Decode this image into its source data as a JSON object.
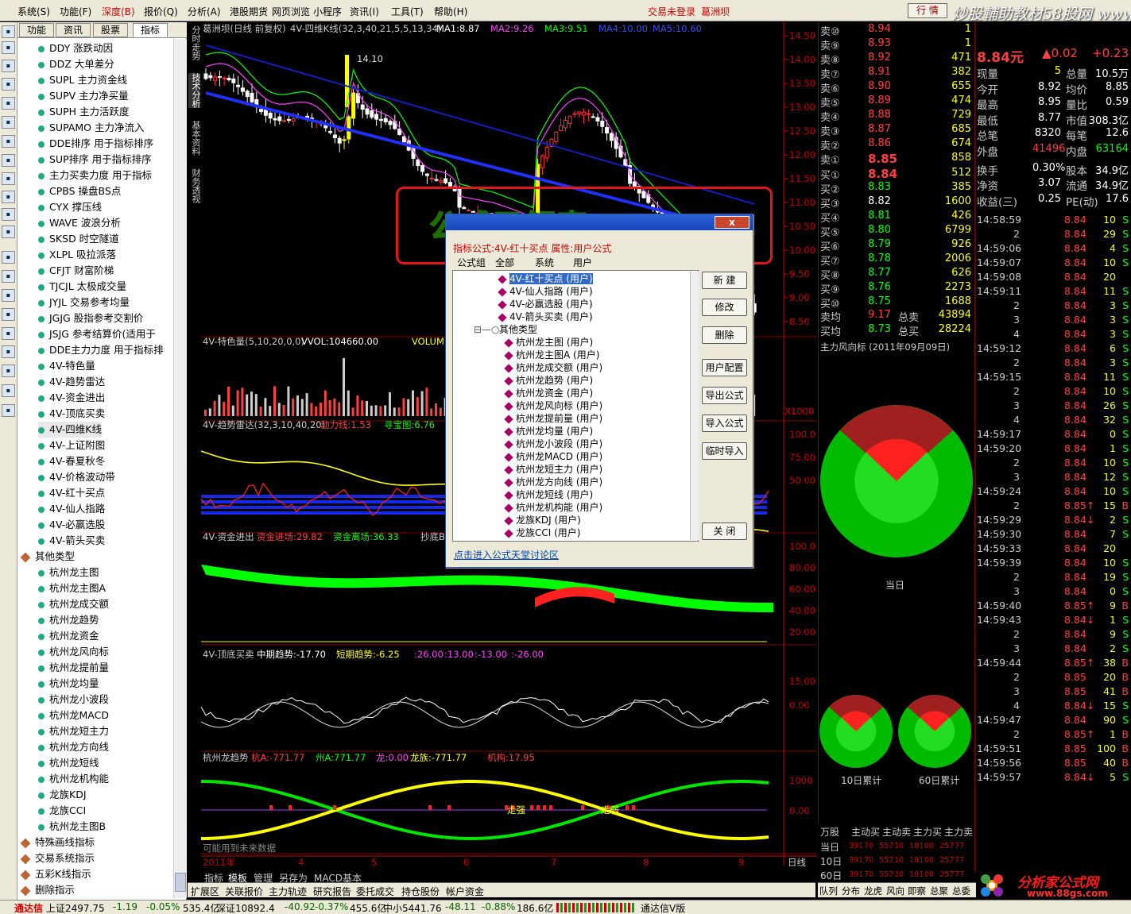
{
  "menubar": {
    "items": [
      "系统(S)",
      "功能(F)",
      "深度(B)",
      "报价(Q)",
      "分析(A)",
      "港股期货",
      "网页浏览",
      "小程序",
      "资讯(I)",
      "工具(T)",
      "帮助(H)"
    ],
    "status": "交易未登录",
    "stock": "葛洲坝",
    "close_label": "行  情",
    "watermark_top": "炒股輔助教材58股网 www.58Gu.com"
  },
  "side_tabs": [
    "功能",
    "资讯",
    "股票",
    "指标"
  ],
  "tree_items": [
    "DDY 涨跌动因",
    "DDZ 大单差分",
    "SUPL 主力资金线",
    "SUPV 主力净买量",
    "SUPH 主力活跃度",
    "SUPAMO 主力净流入",
    "DDE排序 用于指标排序",
    "SUP排序 用于指标排序",
    "主力买卖力度 用于指标",
    "CPBS 操盘BS点",
    "CYX 撑压线",
    "WAVE 波浪分析",
    "SKSD 时空隧道",
    "XLPL 吸拉派落",
    "CFJT 财富阶梯",
    "TJCJL 太极成交量",
    "JYJL 交易参考均量",
    "JGJG 股指参考交割价",
    "JSJG 参考结算价(适用于",
    "DDE主力力度 用于指标排",
    "4V-特色量",
    "4V-趋势雷达",
    "4V-资金进出",
    "4V-顶底买卖",
    "4V-四维K线",
    "4V-上证附图",
    "4V-春夏秋冬",
    "4V-价格波动带",
    "4V-红十买点",
    "4V-仙人指路",
    "4V-必赢选股",
    "4V-箭头买卖"
  ],
  "tree_folder": "其他类型",
  "tree_items2": [
    "杭州龙主图",
    "杭州龙主图A",
    "杭州龙成交额",
    "杭州龙趋势",
    "杭州龙资金",
    "杭州龙风向标",
    "杭州龙提前量",
    "杭州龙均量",
    "杭州龙小波段",
    "杭州龙MACD",
    "杭州龙短主力",
    "杭州龙方向线",
    "杭州龙短线",
    "杭州龙机构能",
    "龙族KDJ",
    "龙族CCI",
    "杭州龙主图B"
  ],
  "tree_bottom": [
    "特殊画线指标",
    "交易系统指示",
    "五彩K线指示",
    "删除指示"
  ],
  "vtabs": [
    "分时走势",
    "技术分析",
    "基本资料",
    "财务透视"
  ],
  "chart": {
    "main_title": "葛洲坝(日线 前复权)",
    "main_formula": "4V-四维K线(32,3,40,21,5,5,13,34)",
    "ma": [
      {
        "label": "MA1:8.87",
        "color": "#ffffff"
      },
      {
        "label": "MA2:9.26",
        "color": "#ff40ff"
      },
      {
        "label": "MA3:9.51",
        "color": "#00ff00"
      },
      {
        "label": "MA4:10.00",
        "color": "#3050ff"
      },
      {
        "label": "MA5:10.60",
        "color": "#3050ff"
      }
    ],
    "price_axis": [
      "14.50",
      "14.00",
      "13.50",
      "13.00",
      "12.50",
      "12.00",
      "11.50",
      "11.00",
      "10.50",
      "10.00",
      "9.50",
      "9.00",
      "8.50"
    ],
    "peak_label": "14.10",
    "low_label": "14.1",
    "vol_title": "4V-特色量(5,10,20,0,0)",
    "vol_vals": "VVOL:104660.00",
    "vol_extra": "VOLUME:10",
    "vol_unit": "X1000",
    "radar_title": "4V-趋势雷达(32,3,10,40,20)",
    "radar_a": "动力线:1.53",
    "radar_b": "寻宝图:6.76",
    "radar_axis": [
      "100.0",
      "75.00",
      "50.00"
    ],
    "fund_title": "4V-资金进出",
    "fund_a": "资金进场:29.82",
    "fund_b": "资金离场:36.33",
    "fund_c": "抄底B",
    "fund_axis": [
      "100.0",
      "80.00",
      "60.00",
      "40.00",
      "20.00"
    ],
    "top_title": "4V-顶底买卖",
    "top_a": "中期趋势:-17.70",
    "top_b": "短期趋势:-6.25",
    "top_c": ":26.00",
    "top_d": ":13.00",
    "top_e": ":-13.00",
    "top_f": ":-26.00",
    "top_axis": [
      "15.00",
      "0.00"
    ],
    "trend_title": "杭州龙趋势",
    "trend_a": "杭A:-771.77",
    "trend_b": "州A:771.77",
    "trend_c": "龙:0.00",
    "trend_d": "龙族:-771.77",
    "trend_e": "机构:17.95",
    "trend_axis": [
      "1000",
      "0.00"
    ],
    "trend_note1": "走强",
    "trend_note2": "走弱",
    "future_note": "可能用到未来数据",
    "date_axis": [
      "2011年",
      "4",
      "5",
      "6",
      "7",
      "8",
      "9"
    ],
    "date_right": "日线"
  },
  "quote": {
    "sell": [
      [
        "卖⑩",
        "8.94",
        "1"
      ],
      [
        "卖⑨",
        "8.93",
        "1"
      ],
      [
        "卖⑧",
        "8.92",
        "471"
      ],
      [
        "卖⑦",
        "8.91",
        "382"
      ],
      [
        "卖⑥",
        "8.90",
        "655"
      ],
      [
        "卖⑤",
        "8.89",
        "474"
      ],
      [
        "卖④",
        "8.88",
        "729"
      ],
      [
        "卖③",
        "8.87",
        "685"
      ],
      [
        "卖②",
        "8.86",
        "674"
      ],
      [
        "卖①",
        "8.85",
        "858"
      ]
    ],
    "buy": [
      [
        "买①",
        "8.84",
        "512"
      ],
      [
        "买②",
        "8.83",
        "385"
      ],
      [
        "买③",
        "8.82",
        "1600"
      ],
      [
        "买④",
        "8.81",
        "426"
      ],
      [
        "买⑤",
        "8.80",
        "6799"
      ],
      [
        "买⑥",
        "8.79",
        "926"
      ],
      [
        "买⑦",
        "8.78",
        "2006"
      ],
      [
        "买⑧",
        "8.77",
        "626"
      ],
      [
        "买⑨",
        "8.76",
        "2273"
      ],
      [
        "买⑩",
        "8.75",
        "1688"
      ]
    ],
    "avg_sell_label": "卖均",
    "avg_sell": "9.17",
    "total_sell_label": "总卖",
    "total_sell": "43894",
    "avg_buy_label": "买均",
    "avg_buy": "8.73",
    "total_buy_label": "总买",
    "total_buy": "28224",
    "main_price": "8.84元",
    "change": "▲0.02",
    "change_pct": "+0.23",
    "stats": [
      [
        "现量",
        "5",
        "总量",
        "10.5万"
      ],
      [
        "今开",
        "8.92",
        "均价",
        "8.85"
      ],
      [
        "最高",
        "8.95",
        "量比",
        "0.59"
      ],
      [
        "最低",
        "8.77",
        "市值",
        "308.3亿"
      ],
      [
        "总笔",
        "8320",
        "每笔",
        "12.6"
      ],
      [
        "外盘",
        "41496",
        "内盘",
        "63164"
      ],
      [
        "换手",
        "0.30%",
        "股本",
        "34.9亿"
      ],
      [
        "净资",
        "3.07",
        "流通",
        "34.9亿"
      ],
      [
        "收益(三)",
        "0.25",
        "PE(动)",
        "17.6"
      ]
    ]
  },
  "pies": {
    "title": "主力风向标 (2011年09月09日)",
    "today": "当日",
    "d10": "10日累计",
    "d60": "60日累计",
    "table_head": [
      "万股",
      "主动买",
      "主动卖",
      "主力买",
      "主力卖"
    ],
    "table_rows": [
      [
        "当日",
        "391",
        "70",
        "557",
        "10",
        "181",
        "00",
        "257",
        "77"
      ],
      [
        "10日",
        "391",
        "70",
        "557",
        "10",
        "181",
        "00",
        "257",
        "77"
      ],
      [
        "60日",
        "391",
        "70",
        "557",
        "10",
        "181",
        "00",
        "257",
        "77"
      ]
    ]
  },
  "ticks": [
    [
      "14:58:59",
      "8.84",
      "10",
      "S"
    ],
    [
      "2",
      "8.84",
      "29",
      "S"
    ],
    [
      "14:59:06",
      "8.84",
      "4",
      "S"
    ],
    [
      "14:59:07",
      "8.84",
      "10",
      "S"
    ],
    [
      "14:59:08",
      "8.84",
      "20",
      ""
    ],
    [
      "14:59:11",
      "8.84",
      "11",
      "S"
    ],
    [
      "2",
      "8.84",
      "3",
      "S"
    ],
    [
      "3",
      "8.84",
      "3",
      "S"
    ],
    [
      "4",
      "8.84",
      "3",
      "S"
    ],
    [
      "14:59:12",
      "8.84",
      "6",
      "S"
    ],
    [
      "2",
      "8.84",
      "3",
      "S"
    ],
    [
      "14:59:15",
      "8.84",
      "11",
      "S"
    ],
    [
      "2",
      "8.84",
      "10",
      "S"
    ],
    [
      "3",
      "8.84",
      "26",
      "S"
    ],
    [
      "4",
      "8.84",
      "32",
      "S"
    ],
    [
      "14:59:17",
      "8.84",
      "0",
      "S"
    ],
    [
      "14:59:20",
      "8.84",
      "1",
      "S"
    ],
    [
      "2",
      "8.84",
      "10",
      "S"
    ],
    [
      "3",
      "8.84",
      "12",
      "S"
    ],
    [
      "14:59:24",
      "8.84",
      "10",
      "S"
    ],
    [
      "2",
      "8.85↑",
      "15",
      "B"
    ],
    [
      "14:59:29",
      "8.84↓",
      "2",
      "S"
    ],
    [
      "14:59:30",
      "8.84",
      "7",
      "S"
    ],
    [
      "14:59:33",
      "8.84",
      "20",
      ""
    ],
    [
      "14:59:39",
      "8.84",
      "10",
      "S"
    ],
    [
      "2",
      "8.84",
      "19",
      "S"
    ],
    [
      "3",
      "8.84",
      "0",
      "S"
    ],
    [
      "14:59:40",
      "8.85↑",
      "9",
      "B"
    ],
    [
      "14:59:43",
      "8.84↓",
      "1",
      "S"
    ],
    [
      "2",
      "8.84",
      "9",
      "S"
    ],
    [
      "3",
      "8.84",
      "2",
      "S"
    ],
    [
      "14:59:44",
      "8.85↑",
      "38",
      "B"
    ],
    [
      "2",
      "8.85",
      "20",
      "B"
    ],
    [
      "3",
      "8.85",
      "41",
      "B"
    ],
    [
      "4",
      "8.84↓",
      "15",
      "S"
    ],
    [
      "14:59:47",
      "8.84",
      "90",
      "S"
    ],
    [
      "2",
      "8.85↑",
      "1",
      "B"
    ],
    [
      "14:59:51",
      "8.85",
      "100",
      "B"
    ],
    [
      "14:59:56",
      "8.85",
      "40",
      "B"
    ],
    [
      "14:59:57",
      "8.84↓",
      "5",
      "S"
    ]
  ],
  "bottom": {
    "small_tabs": [
      "指标",
      "模板",
      "管理",
      "另存为",
      "MACD基本"
    ],
    "tabs": [
      "扩展区",
      "关联报价",
      "主力轨迹",
      "研究报告",
      "委托成交",
      "持仓股份",
      "帐户资金"
    ],
    "right_tabs": [
      "队列",
      "分布",
      "龙虎",
      "风向",
      "即察",
      "总聚",
      "总委"
    ]
  },
  "statusbar": {
    "app": "通达信",
    "sh": "上证2497.75",
    "sh_chg": "-1.19",
    "sh_pct": "-0.05%",
    "sh_amt": "535.4亿",
    "sz": "深证10892.4",
    "sz_chg": "-40.92",
    "sz_pct": "-0.37%",
    "sz_amt": "455.6亿",
    "zx": "中小5441.76",
    "zx_chg": "-48.11",
    "zx_pct": "-0.88%",
    "zx_amt": "186.6亿",
    "version": "通达信V版"
  },
  "dialog": {
    "info": "指标公式:4V-红十买点  属性:用户公式",
    "tabs": [
      "公式组",
      "全部",
      "系统",
      "用户"
    ],
    "list_user": [
      "4V-红十买点  (用户)",
      "4V-仙人指路  (用户)",
      "4V-必赢选股  (用户)",
      "4V-箭头买卖  (用户)"
    ],
    "folder": "其他类型",
    "list_other": [
      "杭州龙主图  (用户)",
      "杭州龙主图A  (用户)",
      "杭州龙成交额  (用户)",
      "杭州龙趋势  (用户)",
      "杭州龙资金  (用户)",
      "杭州龙风向标  (用户)",
      "杭州龙提前量  (用户)",
      "杭州龙均量  (用户)",
      "杭州龙小波段  (用户)",
      "杭州龙MACD  (用户)",
      "杭州龙短主力  (用户)",
      "杭州龙方向线  (用户)",
      "杭州龙短线  (用户)",
      "杭州龙机构能  (用户)",
      "龙族KDJ  (用户)",
      "龙族CCI  (用户)"
    ],
    "buttons": [
      "新  建",
      "修改",
      "删除",
      "用户配置",
      "导出公式",
      "导入公式",
      "临时导入",
      "关  闭"
    ],
    "link": "点击进入公式天堂讨论区",
    "banner": "公式已解密",
    "close": "x"
  },
  "watermark_bottom": {
    "cn": "分析家公式网",
    "url": "www.88gs.com"
  },
  "colors": {
    "up": "#ff3232",
    "down": "#00e600",
    "yellow": "#ffff00",
    "axis": "#c00000"
  }
}
